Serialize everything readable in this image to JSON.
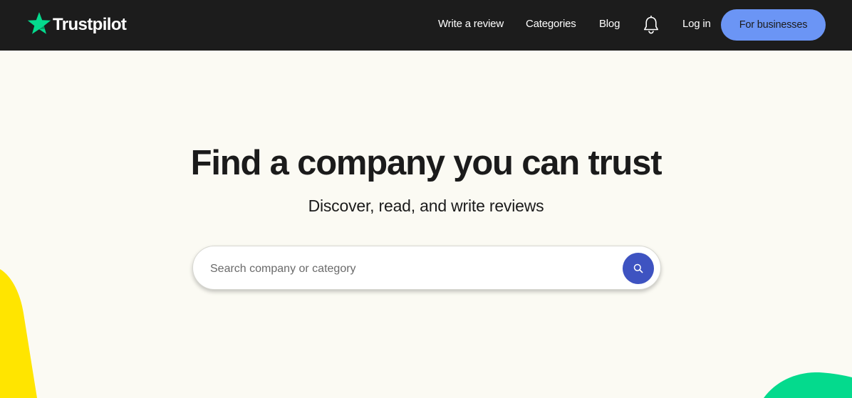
{
  "header": {
    "logo_text": "Trustpilot",
    "logo_icon": "star-icon",
    "nav": {
      "write_review": "Write a review",
      "categories": "Categories",
      "blog": "Blog",
      "notifications_icon": "bell-icon",
      "login": "Log in",
      "for_businesses": "For businesses"
    }
  },
  "hero": {
    "title": "Find a company you can trust",
    "subtitle": "Discover, read, and write reviews"
  },
  "search": {
    "value": "",
    "placeholder": "Search company or category",
    "button_icon": "search-icon"
  },
  "colors": {
    "header_bg": "#1c1c1c",
    "page_bg": "#fbfaf3",
    "brand_green": "#04da8d",
    "business_button": "#6b95f5",
    "search_button": "#3e53c1",
    "accent_yellow": "#ffe500"
  }
}
